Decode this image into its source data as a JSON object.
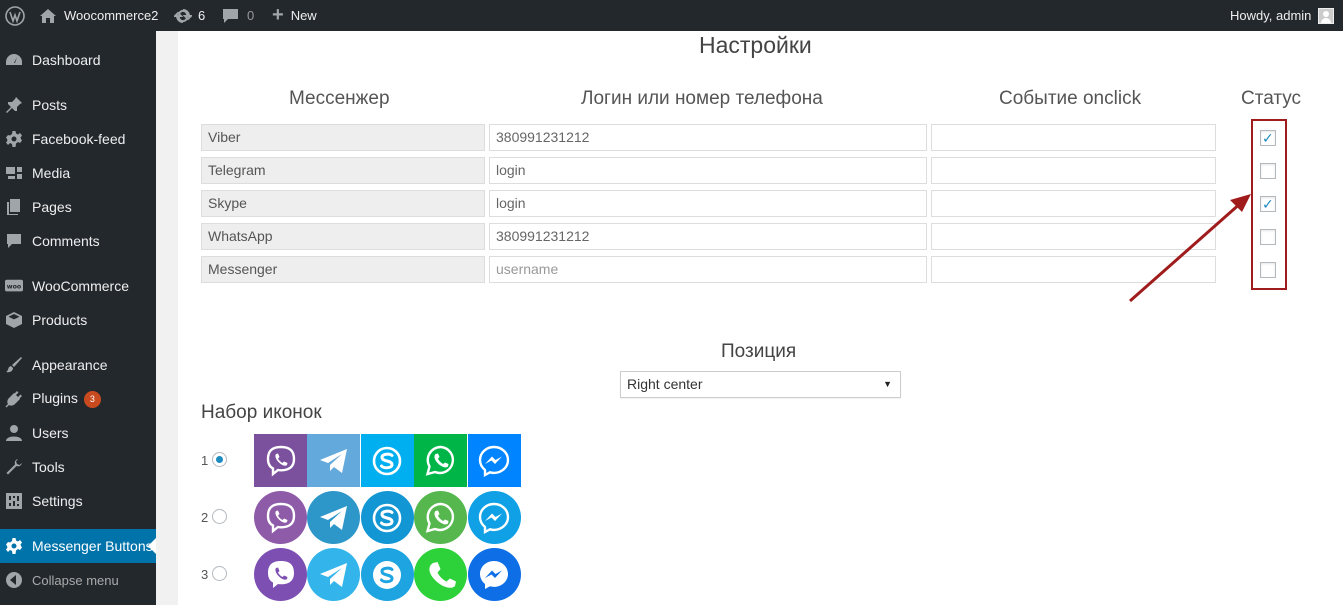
{
  "adminbar": {
    "site_name": "Woocommerce2",
    "updates_count": "6",
    "comments_count": "0",
    "new_label": "New",
    "howdy": "Howdy, admin"
  },
  "sidebar": {
    "items": [
      {
        "label": "Dashboard",
        "icon": "dashboard-icon"
      },
      {
        "label": "Posts",
        "icon": "pin-icon"
      },
      {
        "label": "Facebook-feed",
        "icon": "gear-icon"
      },
      {
        "label": "Media",
        "icon": "media-icon"
      },
      {
        "label": "Pages",
        "icon": "pages-icon"
      },
      {
        "label": "Comments",
        "icon": "comment-icon"
      },
      {
        "label": "WooCommerce",
        "icon": "woo-icon"
      },
      {
        "label": "Products",
        "icon": "box-icon"
      },
      {
        "label": "Appearance",
        "icon": "brush-icon"
      },
      {
        "label": "Plugins",
        "icon": "plug-icon",
        "badge": "3"
      },
      {
        "label": "Users",
        "icon": "user-icon"
      },
      {
        "label": "Tools",
        "icon": "wrench-icon"
      },
      {
        "label": "Settings",
        "icon": "settings-icon"
      },
      {
        "label": "Messenger Buttons",
        "icon": "gear-icon",
        "current": true
      },
      {
        "label": "Collapse menu",
        "icon": "collapse-icon"
      }
    ]
  },
  "main": {
    "title": "Настройки",
    "columns": {
      "messenger": "Мессенжер",
      "login": "Логин или номер телефона",
      "event": "Событие onclick",
      "status": "Статус"
    },
    "rows": [
      {
        "name": "Viber",
        "login": "380991231212",
        "login_is_placeholder": false,
        "event": "",
        "checked": true
      },
      {
        "name": "Telegram",
        "login": "login",
        "login_is_placeholder": false,
        "event": "",
        "checked": false
      },
      {
        "name": "Skype",
        "login": "login",
        "login_is_placeholder": false,
        "event": "",
        "checked": true
      },
      {
        "name": "WhatsApp",
        "login": "380991231212",
        "login_is_placeholder": false,
        "event": "",
        "checked": false
      },
      {
        "name": "Messenger",
        "login": "username",
        "login_is_placeholder": true,
        "event": "",
        "checked": false
      }
    ],
    "position_label": "Позиция",
    "position_value": "Right center",
    "iconset_label": "Набор иконок",
    "iconsets": [
      {
        "number": "1",
        "selected": true,
        "shape": "square"
      },
      {
        "number": "2",
        "selected": false,
        "shape": "circle"
      },
      {
        "number": "3",
        "selected": false,
        "shape": "circle"
      }
    ],
    "iconset_colors": {
      "1": [
        "#7b519d",
        "#64a9dc",
        "#00aff0",
        "#00b548",
        "#0084ff"
      ],
      "2": [
        "#8e5ba8",
        "#2e97ca",
        "#1296d4",
        "#55b74e",
        "#0fa0e5"
      ],
      "3": [
        "#7d4fb3",
        "#33b5ec",
        "#1ea4e1",
        "#2dd13a",
        "#0d6ee6"
      ]
    }
  },
  "accent": "#0073aa",
  "highlight_color": "#a01c1c"
}
